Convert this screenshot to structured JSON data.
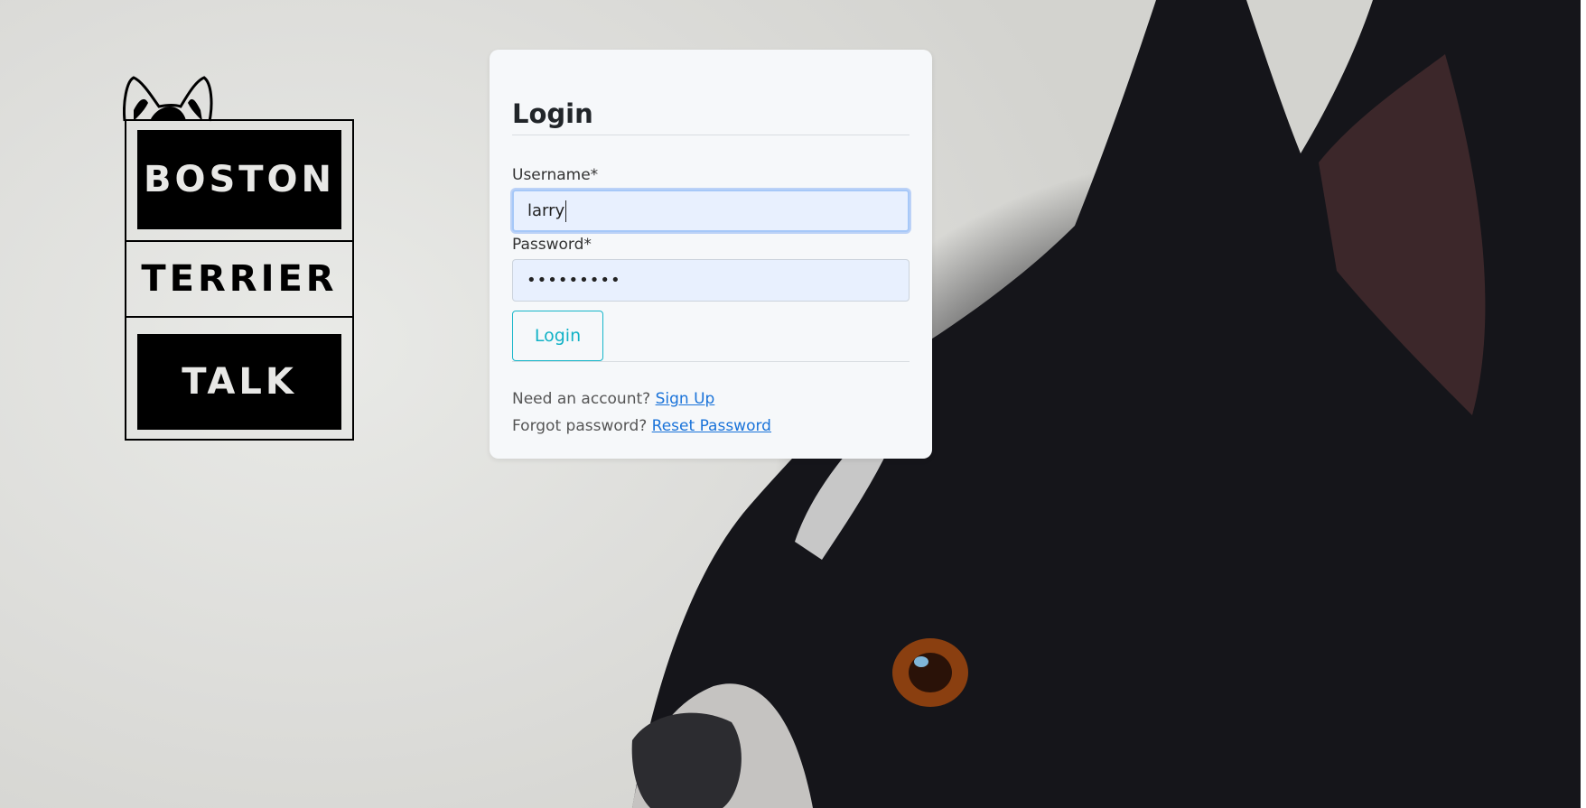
{
  "logo": {
    "line1": "BOSTON",
    "line2": "TERRIER",
    "line3": "TALK"
  },
  "login": {
    "title": "Login",
    "username_label": "Username*",
    "username_value": "larry",
    "password_label": "Password*",
    "password_value": "•••••••••",
    "button_label": "Login",
    "signup_prompt": "Need an account?",
    "signup_link": "Sign Up",
    "forgot_prompt": "Forgot password?",
    "reset_link": "Reset Password"
  },
  "icons": {
    "logo_ears": "dog-ears-icon",
    "background": "boston-terrier-photo"
  },
  "colors": {
    "button_accent": "#17b6c9",
    "link": "#1a73d9",
    "input_bg": "#e8f0fe"
  }
}
